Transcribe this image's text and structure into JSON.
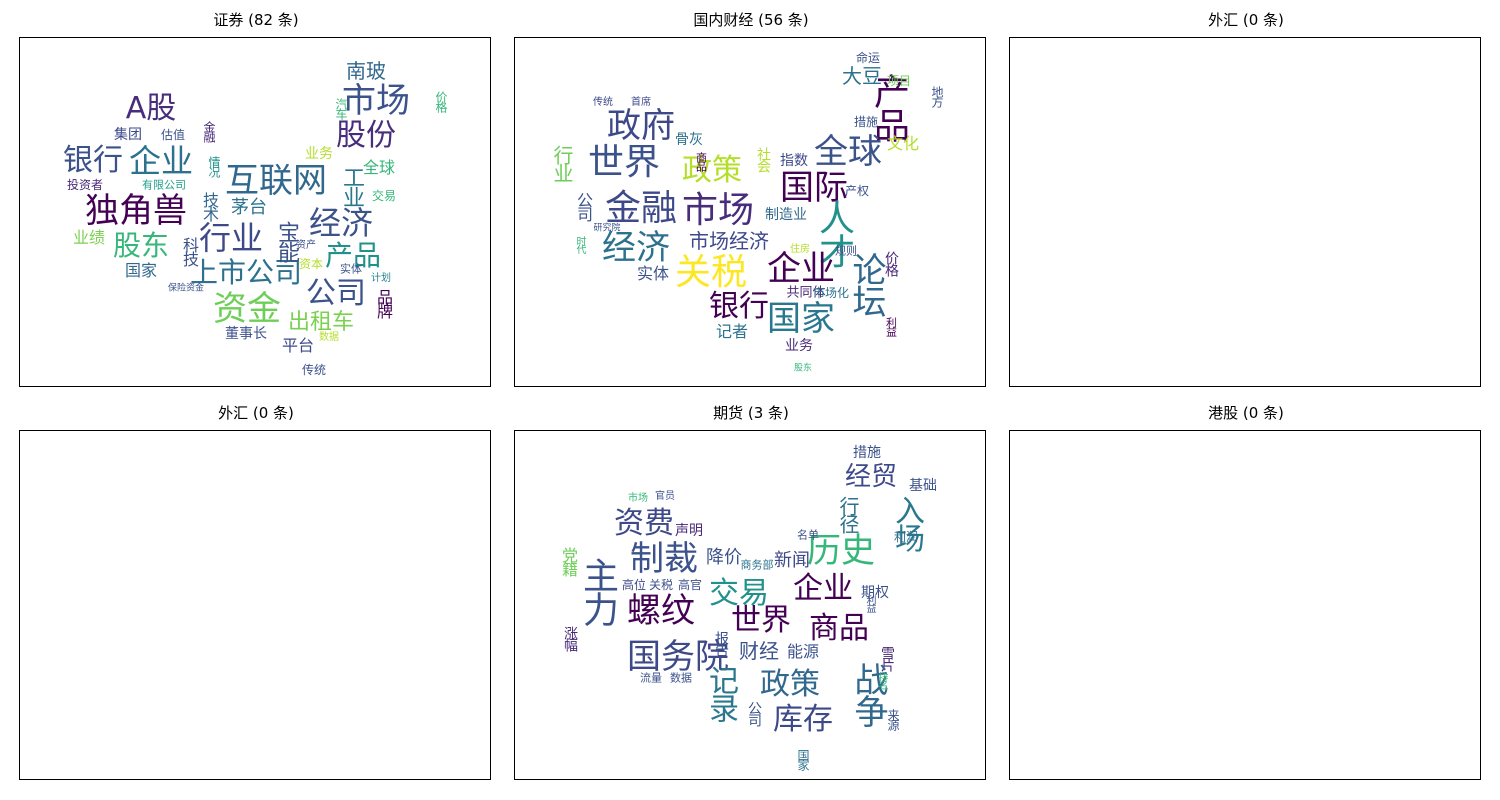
{
  "panels": [
    {
      "title": "证券 (82 条)",
      "words": [
        {
          "text": "市场",
          "color": "#3b528b"
        },
        {
          "text": "股份",
          "color": "#472d7b"
        },
        {
          "text": "南玻",
          "color": "#31688e"
        },
        {
          "text": "A股",
          "color": "#472d7b"
        },
        {
          "text": "银行",
          "color": "#3b528b"
        },
        {
          "text": "企业",
          "color": "#2c728e"
        },
        {
          "text": "互联网",
          "color": "#31688e"
        },
        {
          "text": "独角兽",
          "color": "#440154"
        },
        {
          "text": "经济",
          "color": "#3b528b"
        },
        {
          "text": "行业",
          "color": "#3e4989"
        },
        {
          "text": "股东",
          "color": "#35b779"
        },
        {
          "text": "产品",
          "color": "#21918c"
        },
        {
          "text": "上市公司",
          "color": "#2c728e"
        },
        {
          "text": "公司",
          "color": "#3b528b"
        },
        {
          "text": "资金",
          "color": "#6ece58"
        },
        {
          "text": "出租车",
          "color": "#7ad151"
        },
        {
          "text": "集团",
          "color": "#3e4989"
        },
        {
          "text": "估值",
          "color": "#3b528b"
        },
        {
          "text": "金融",
          "color": "#482878"
        },
        {
          "text": "业务",
          "color": "#b5de2b"
        },
        {
          "text": "全球",
          "color": "#35b779"
        },
        {
          "text": "工业",
          "color": "#2a788e"
        },
        {
          "text": "交易",
          "color": "#35b779"
        },
        {
          "text": "茅台",
          "color": "#2c728e"
        },
        {
          "text": "宝能",
          "color": "#3b528b"
        },
        {
          "text": "业绩",
          "color": "#7ad151"
        },
        {
          "text": "国家",
          "color": "#31688e"
        },
        {
          "text": "资本",
          "color": "#b5de2b"
        },
        {
          "text": "实体",
          "color": "#3b528b"
        },
        {
          "text": "品牌",
          "color": "#440154"
        },
        {
          "text": "董事长",
          "color": "#3b528b"
        },
        {
          "text": "平台",
          "color": "#3e4989"
        },
        {
          "text": "数据",
          "color": "#b5de2b"
        },
        {
          "text": "传统",
          "color": "#3b528b"
        },
        {
          "text": "投资者",
          "color": "#482878"
        },
        {
          "text": "有限公司",
          "color": "#1f9e89"
        },
        {
          "text": "技术",
          "color": "#31688e"
        },
        {
          "text": "情况",
          "color": "#21918c"
        },
        {
          "text": "科技",
          "color": "#3b528b"
        },
        {
          "text": "汽车",
          "color": "#35b779"
        },
        {
          "text": "价格",
          "color": "#35b779"
        },
        {
          "text": "计划",
          "color": "#26828e"
        },
        {
          "text": "资产",
          "color": "#3b528b"
        },
        {
          "text": "保险资金",
          "color": "#3b528b"
        }
      ]
    },
    {
      "title": "国内财经 (56 条)",
      "words": [
        {
          "text": "产品",
          "color": "#440154"
        },
        {
          "text": "大豆",
          "color": "#2c728e"
        },
        {
          "text": "命运",
          "color": "#3b528b"
        },
        {
          "text": "项目",
          "color": "#6ece58"
        },
        {
          "text": "地方",
          "color": "#3b528b"
        },
        {
          "text": "政府",
          "color": "#3e4989"
        },
        {
          "text": "世界",
          "color": "#3b528b"
        },
        {
          "text": "政策",
          "color": "#b5de2b"
        },
        {
          "text": "全球",
          "color": "#3b528b"
        },
        {
          "text": "文化",
          "color": "#b5de2b"
        },
        {
          "text": "国际",
          "color": "#440154"
        },
        {
          "text": "行业",
          "color": "#6ece58"
        },
        {
          "text": "金融",
          "color": "#3e4989"
        },
        {
          "text": "市场",
          "color": "#472d7b"
        },
        {
          "text": "人才",
          "color": "#21918c"
        },
        {
          "text": "经济",
          "color": "#2c728e"
        },
        {
          "text": "市场经济",
          "color": "#3e4989"
        },
        {
          "text": "关税",
          "color": "#fde725"
        },
        {
          "text": "企业",
          "color": "#440154"
        },
        {
          "text": "论坛",
          "color": "#31688e"
        },
        {
          "text": "实体",
          "color": "#3b528b"
        },
        {
          "text": "银行",
          "color": "#440154"
        },
        {
          "text": "国家",
          "color": "#2a788e"
        },
        {
          "text": "记者",
          "color": "#2c728e"
        },
        {
          "text": "业务",
          "color": "#482878"
        },
        {
          "text": "骨灰",
          "color": "#2c728e"
        },
        {
          "text": "指数",
          "color": "#3e4989"
        },
        {
          "text": "制造业",
          "color": "#31688e"
        },
        {
          "text": "产权",
          "color": "#3b528b"
        },
        {
          "text": "共同体",
          "color": "#482878"
        },
        {
          "text": "市场化",
          "color": "#2c728e"
        },
        {
          "text": "价格",
          "color": "#482878"
        },
        {
          "text": "利益",
          "color": "#440154"
        },
        {
          "text": "社会",
          "color": "#b5de2b"
        },
        {
          "text": "措施",
          "color": "#3b528b"
        },
        {
          "text": "首席",
          "color": "#3e4989"
        },
        {
          "text": "公司",
          "color": "#3b528b"
        },
        {
          "text": "时代",
          "color": "#35b779"
        },
        {
          "text": "规则",
          "color": "#3b528b"
        },
        {
          "text": "住房",
          "color": "#b5de2b"
        },
        {
          "text": "传统",
          "color": "#3e4989"
        },
        {
          "text": "商品",
          "color": "#440154"
        },
        {
          "text": "研究院",
          "color": "#3b528b"
        },
        {
          "text": "股东",
          "color": "#35b779"
        }
      ]
    },
    {
      "title": "外汇 (0 条)",
      "words": []
    },
    {
      "title": "外汇 (0 条)",
      "words": []
    },
    {
      "title": "期货 (3 条)",
      "words": [
        {
          "text": "措施",
          "color": "#3b528b"
        },
        {
          "text": "经贸",
          "color": "#3e4989"
        },
        {
          "text": "基础",
          "color": "#3b528b"
        },
        {
          "text": "入场",
          "color": "#2a788e"
        },
        {
          "text": "官员",
          "color": "#3b528b"
        },
        {
          "text": "市场",
          "color": "#35b779"
        },
        {
          "text": "资费",
          "color": "#3e4989"
        },
        {
          "text": "行径",
          "color": "#2c728e"
        },
        {
          "text": "历史",
          "color": "#35b779"
        },
        {
          "text": "利润",
          "color": "#2c728e"
        },
        {
          "text": "声明",
          "color": "#482878"
        },
        {
          "text": "制裁",
          "color": "#3b528b"
        },
        {
          "text": "党籍",
          "color": "#6ece58"
        },
        {
          "text": "降价",
          "color": "#3b528b"
        },
        {
          "text": "新闻",
          "color": "#3e4989"
        },
        {
          "text": "名单",
          "color": "#3b528b"
        },
        {
          "text": "商务部",
          "color": "#2c728e"
        },
        {
          "text": "主力",
          "color": "#3b528b"
        },
        {
          "text": "高位",
          "color": "#3e4989"
        },
        {
          "text": "关税",
          "color": "#3b528b"
        },
        {
          "text": "高官",
          "color": "#3b528b"
        },
        {
          "text": "螺纹",
          "color": "#440154"
        },
        {
          "text": "交易",
          "color": "#21918c"
        },
        {
          "text": "企业",
          "color": "#440154"
        },
        {
          "text": "期权",
          "color": "#3b528b"
        },
        {
          "text": "世界",
          "color": "#440154"
        },
        {
          "text": "商品",
          "color": "#440154"
        },
        {
          "text": "国务院",
          "color": "#3e4989"
        },
        {
          "text": "财经",
          "color": "#3b528b"
        },
        {
          "text": "能源",
          "color": "#3b528b"
        },
        {
          "text": "涨幅",
          "color": "#482878"
        },
        {
          "text": "雪片",
          "color": "#482878"
        },
        {
          "text": "记录",
          "color": "#2a788e"
        },
        {
          "text": "政策",
          "color": "#31688e"
        },
        {
          "text": "战争",
          "color": "#31688e"
        },
        {
          "text": "库存",
          "color": "#3e4989"
        },
        {
          "text": "报告",
          "color": "#3b528b"
        },
        {
          "text": "流量",
          "color": "#3b528b"
        },
        {
          "text": "数据",
          "color": "#3b528b"
        },
        {
          "text": "公司",
          "color": "#3b528b"
        },
        {
          "text": "国家",
          "color": "#2c728e"
        },
        {
          "text": "来源",
          "color": "#3b528b"
        },
        {
          "text": "利益",
          "color": "#3b528b"
        },
        {
          "text": "排名",
          "color": "#35b779"
        }
      ]
    },
    {
      "title": "港股 (0 条)",
      "words": []
    }
  ]
}
